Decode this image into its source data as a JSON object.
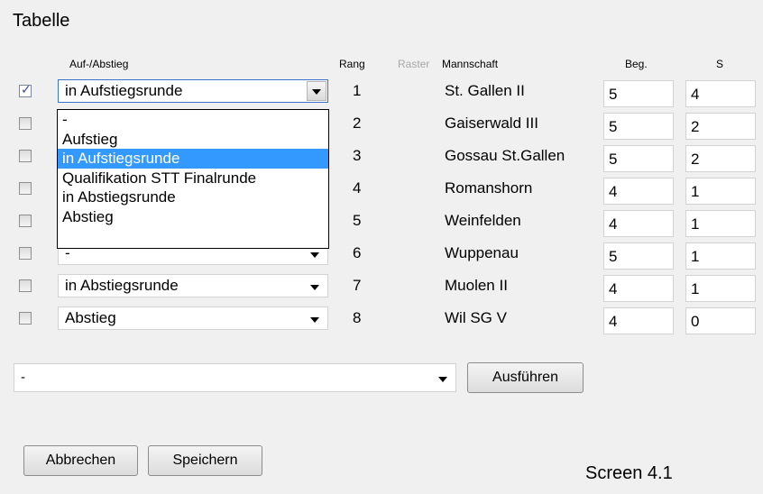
{
  "title": "Tabelle",
  "headers": {
    "auf_abstieg": "Auf-/Abstieg",
    "rang": "Rang",
    "raster": "Raster",
    "mannschaft": "Mannschaft",
    "beg": "Beg.",
    "s": "S"
  },
  "rows": [
    {
      "checked": true,
      "status": "in Aufstiegsrunde",
      "rang": "1",
      "team": "St. Gallen II",
      "beg": "5",
      "s": "4"
    },
    {
      "checked": false,
      "status": "",
      "rang": "2",
      "team": "Gaiserwald III",
      "beg": "5",
      "s": "2"
    },
    {
      "checked": false,
      "status": "",
      "rang": "3",
      "team": "Gossau St.Gallen",
      "beg": "5",
      "s": "2"
    },
    {
      "checked": false,
      "status": "",
      "rang": "4",
      "team": "Romanshorn",
      "beg": "4",
      "s": "1"
    },
    {
      "checked": false,
      "status": "",
      "rang": "5",
      "team": "Weinfelden",
      "beg": "4",
      "s": "1"
    },
    {
      "checked": false,
      "status": "-",
      "rang": "6",
      "team": "Wuppenau",
      "beg": "5",
      "s": "1"
    },
    {
      "checked": false,
      "status": "in Abstiegsrunde",
      "rang": "7",
      "team": "Muolen II",
      "beg": "4",
      "s": "1"
    },
    {
      "checked": false,
      "status": "Abstieg",
      "rang": "8",
      "team": "Wil SG V",
      "beg": "4",
      "s": "0"
    }
  ],
  "dropdown_options": [
    "-",
    "Aufstieg",
    "in Aufstiegsrunde",
    "Qualifikation STT Finalrunde",
    "in Abstiegsrunde",
    "Abstieg"
  ],
  "dropdown_highlighted": "in Aufstiegsrunde",
  "bulk_action": {
    "value": "-",
    "execute_label": "Ausführen"
  },
  "buttons": {
    "cancel": "Abbrechen",
    "save": "Speichern"
  },
  "caption": "Screen 4.1",
  "colors": {
    "highlight": "#3399ff",
    "background": "#f0f0f0"
  }
}
